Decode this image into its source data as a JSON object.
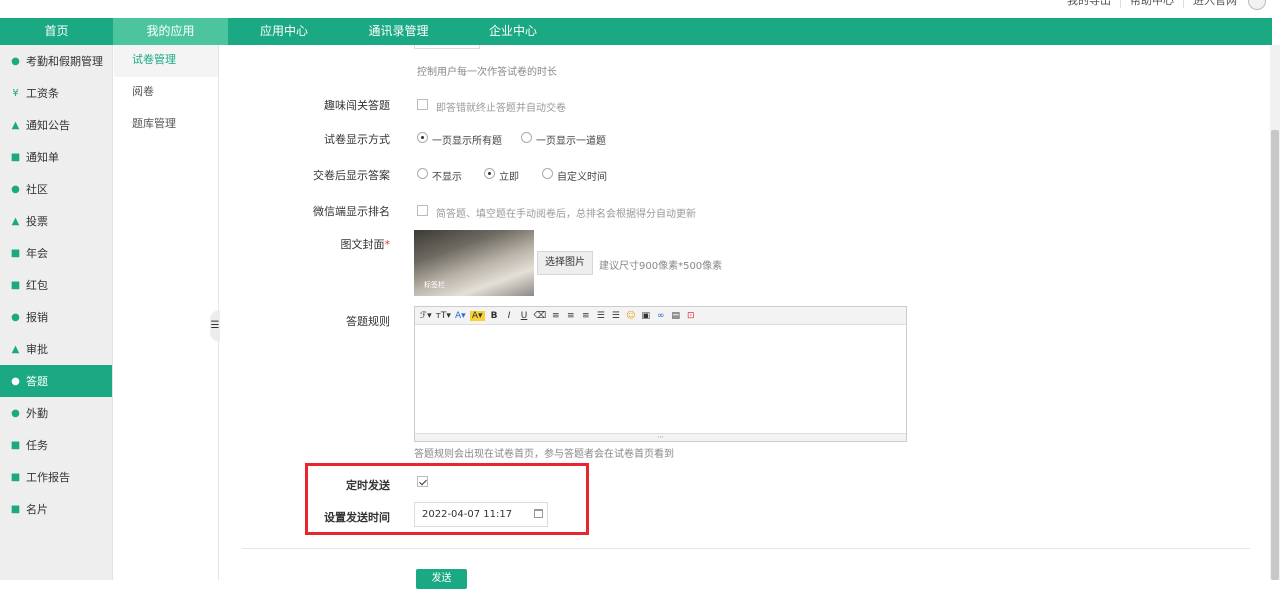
{
  "header": {
    "top_links": [
      "我的导出",
      "帮助中心",
      "进入官网"
    ]
  },
  "nav": {
    "items": [
      {
        "label": "首页"
      },
      {
        "label": "我的应用"
      },
      {
        "label": "应用中心"
      },
      {
        "label": "通讯录管理"
      },
      {
        "label": "企业中心"
      }
    ],
    "active_index": 1
  },
  "sidebar": {
    "items": [
      {
        "label": "考勤和假期管理",
        "icon": "person-icon"
      },
      {
        "label": "工资条",
        "icon": "yen-icon"
      },
      {
        "label": "通知公告",
        "icon": "bell-icon"
      },
      {
        "label": "通知单",
        "icon": "list-icon"
      },
      {
        "label": "社区",
        "icon": "chat-icon"
      },
      {
        "label": "投票",
        "icon": "vote-icon"
      },
      {
        "label": "年会",
        "icon": "mail-icon"
      },
      {
        "label": "红包",
        "icon": "redpacket-icon"
      },
      {
        "label": "报销",
        "icon": "money-icon"
      },
      {
        "label": "审批",
        "icon": "stamp-icon"
      },
      {
        "label": "答题",
        "icon": "pill-icon"
      },
      {
        "label": "外勤",
        "icon": "location-icon"
      },
      {
        "label": "任务",
        "icon": "task-icon"
      },
      {
        "label": "工作报告",
        "icon": "report-icon"
      },
      {
        "label": "名片",
        "icon": "card-icon"
      }
    ],
    "active_index": 10
  },
  "submenu": {
    "items": [
      {
        "label": "试卷管理"
      },
      {
        "label": "阅卷"
      },
      {
        "label": "题库管理"
      }
    ],
    "active_index": 0
  },
  "form": {
    "time_limit_hint": "控制用户每一次作答试卷的时长",
    "fun_mode": {
      "label": "趣味闯关答题",
      "option": "即答错就终止答题并自动交卷",
      "checked": false
    },
    "display_mode": {
      "label": "试卷显示方式",
      "options": [
        "一页显示所有题",
        "一页显示一道题"
      ],
      "selected": 0
    },
    "show_answer": {
      "label": "交卷后显示答案",
      "options": [
        "不显示",
        "立即",
        "自定义时间"
      ],
      "selected": 1
    },
    "wechat_rank": {
      "label": "微信端显示排名",
      "option": "简答题、填空题在手动阅卷后，总排名会根据得分自动更新",
      "checked": false
    },
    "cover": {
      "label": "图文封面",
      "required_mark": "*",
      "select_button": "选择图片",
      "size_hint": "建议尺寸900像素*500像素",
      "image_caption": "标签栏"
    },
    "rules": {
      "label": "答题规则",
      "hint": "答题规则会出现在试卷首页，参与答题者会在试卷首页看到"
    },
    "timed_send": {
      "label": "定时发送",
      "checked": true
    },
    "send_time": {
      "label": "设置发送时间",
      "value": "2022-04-07 11:17"
    },
    "send_button": "发送"
  },
  "colors": {
    "accent": "#1aa983",
    "highlight": "#e8262d"
  }
}
